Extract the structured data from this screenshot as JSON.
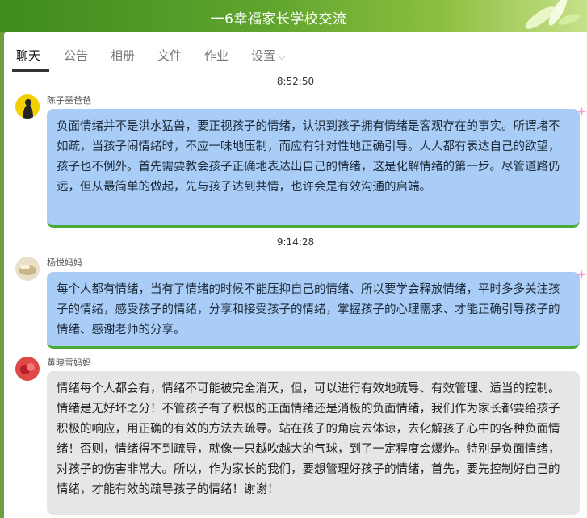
{
  "header": {
    "title": "一6幸福家长学校交流"
  },
  "tabs": [
    {
      "label": "聊天",
      "active": true
    },
    {
      "label": "公告"
    },
    {
      "label": "相册"
    },
    {
      "label": "文件"
    },
    {
      "label": "作业"
    },
    {
      "label": "设置"
    }
  ],
  "messages": [
    {
      "time": "8:52:50",
      "sender": "陈子墨爸爸",
      "avatar_icon": "avatar-yellow-icon",
      "text": "负面情绪并不是洪水猛兽，要正视孩子的情绪，认识到孩子拥有情绪是客观存在的事实。所谓堵不如疏，当孩子闹情绪时，不应一味地压制，而应有针对性地正确引导。人人都有表达自己的欲望，孩子也不例外。首先需要教会孩子正确地表达出自己的情绪，这是化解情绪的第一步。尽管道路仍远，但从最简单的做起，先与孩子达到共情，也许会是有效沟通的启端。"
    },
    {
      "time": "9:14:28",
      "sender": "杨悦妈妈",
      "avatar_icon": "avatar-beige-icon",
      "text": "每个人都有情绪，当有了情绪的时候不能压抑自己的情绪、所以要学会释放情绪，平时多多关注孩子的情绪，感受孩子的情绪，分享和接受孩子的情绪，掌握孩子的心理需求、才能正确引导孩子的情绪、感谢老师的分享。"
    },
    {
      "sender": "黄晓雪妈妈",
      "avatar_icon": "avatar-red-icon",
      "text": "情绪每个人都会有，情绪不可能被完全消灭，但，可以进行有效地疏导、有效管理、适当的控制。情绪是无好坏之分！不管孩子有了积极的正面情绪还是消极的负面情绪，我们作为家长都要给孩子积极的响应，用正确的有效的方法去疏导。站在孩子的角度去体谅，去化解孩子心中的各种负面情绪！否则，情绪得不到疏导，就像一只越吹越大的气球，到了一定程度会爆炸。特别是负面情绪，对孩子的伤害非常大。所以，作为家长的我们，要想管理好孩子的情绪，首先，要先控制好自己的情绪，才能有效的疏导孩子的情绪！谢谢！"
    }
  ],
  "colors": {
    "bubble_blue": "#a9cdf6",
    "bubble_gray": "#e6e6e6",
    "accent_green": "#4bab3a"
  }
}
